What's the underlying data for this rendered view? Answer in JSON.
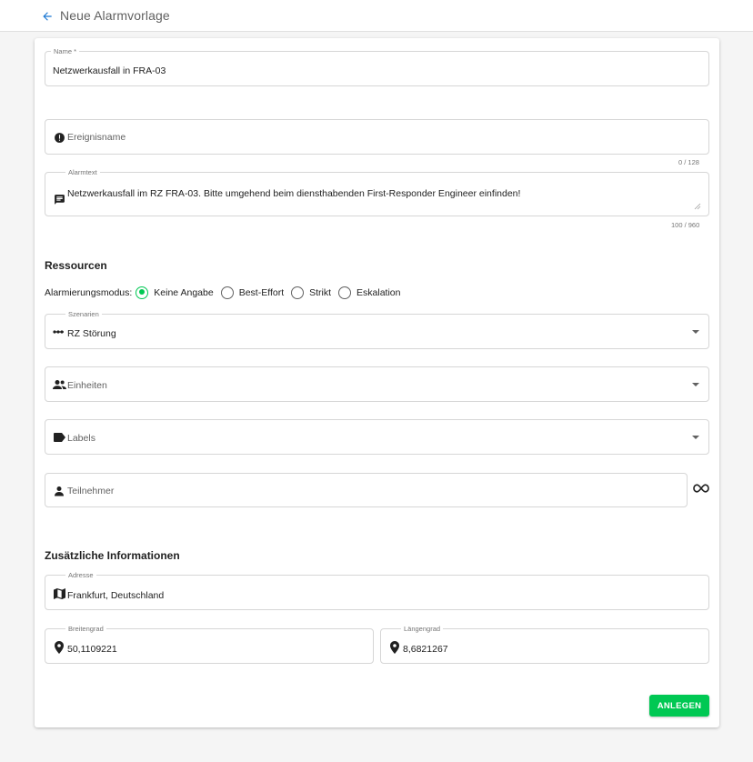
{
  "header": {
    "title": "Neue Alarmvorlage"
  },
  "form": {
    "name": {
      "label": "Name *",
      "value": "Netzwerkausfall in FRA-03"
    },
    "event_name": {
      "placeholder": "Ereignisname",
      "counter": "0 / 128"
    },
    "alarm_text": {
      "label": "Alarmtext",
      "value": "Netzwerkausfall im RZ FRA-03. Bitte umgehend beim diensthabenden First-Responder Engineer einfinden!",
      "counter": "100 / 960"
    }
  },
  "resources": {
    "title": "Ressourcen",
    "mode_label": "Alarmierungsmodus:",
    "modes": [
      {
        "label": "Keine Angabe",
        "selected": true
      },
      {
        "label": "Best-Effort",
        "selected": false
      },
      {
        "label": "Strikt",
        "selected": false
      },
      {
        "label": "Eskalation",
        "selected": false
      }
    ],
    "scenarios": {
      "label": "Szenarien",
      "value": "RZ Störung"
    },
    "units": {
      "placeholder": "Einheiten"
    },
    "labels": {
      "placeholder": "Labels"
    },
    "participants": {
      "placeholder": "Teilnehmer"
    }
  },
  "additional": {
    "title": "Zusätzliche Informationen",
    "address": {
      "label": "Adresse",
      "value": "Frankfurt, Deutschland"
    },
    "latitude": {
      "label": "Breitengrad",
      "value": "50,1109221"
    },
    "longitude": {
      "label": "Längengrad",
      "value": "8,6821267"
    }
  },
  "actions": {
    "submit_label": "ANLEGEN"
  },
  "colors": {
    "accent": "#00c853",
    "back_arrow": "#1976d2"
  }
}
